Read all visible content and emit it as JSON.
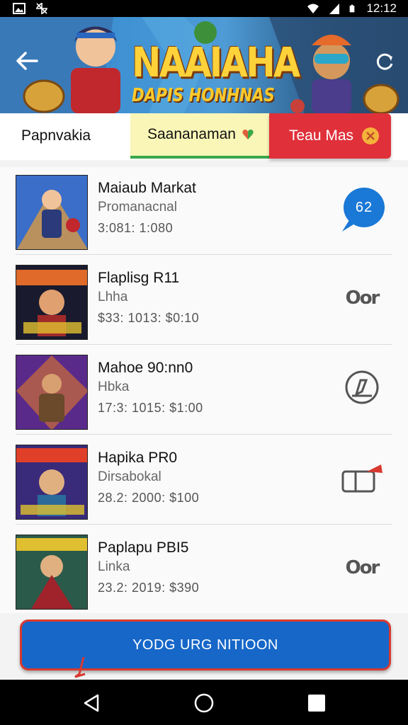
{
  "status_bar": {
    "time": "12:12"
  },
  "banner": {
    "title": "NAAIAHA",
    "subtitle": "DAPIS HONHNAS"
  },
  "tabs": [
    {
      "label": "Papnvakia"
    },
    {
      "label": "Saananaman"
    },
    {
      "label": "Teau Mas"
    }
  ],
  "items": [
    {
      "title": "Maiaub Markat",
      "subtitle": "Promanacnal",
      "meta": "3:081: 1:080",
      "action": "62"
    },
    {
      "title": "Flaplisg R11",
      "subtitle": "Lhha",
      "meta": "$33: 1013: $0:10",
      "action": "Oor"
    },
    {
      "title": "Mahoe 90:nn0",
      "subtitle": "Hbka",
      "meta": "17:3: 1015: $1:00",
      "action": ""
    },
    {
      "title": "Hapika PR0",
      "subtitle": "Dirsabokal",
      "meta": "28.2: 2000: $100",
      "action": ""
    },
    {
      "title": "Paplapu PBI5",
      "subtitle": "Linka",
      "meta": "23.2: 2019: $390",
      "action": "Oor"
    }
  ],
  "cta": {
    "label": "YODG URG NITIOON"
  },
  "colors": {
    "accent_blue": "#1667c8",
    "tab_red": "#e0303a",
    "tab_yellow": "#f9f6b8",
    "badge_blue": "#1a78d6"
  },
  "icons": [
    "gallery-icon",
    "app-icon",
    "wifi-icon",
    "signal-icon",
    "battery-icon",
    "back-arrow-icon",
    "refresh-icon",
    "heart-icon",
    "close-icon",
    "chat-badge-icon",
    "edit-icon",
    "cart-icon",
    "nav-back-icon",
    "nav-home-icon",
    "nav-recents-icon"
  ]
}
